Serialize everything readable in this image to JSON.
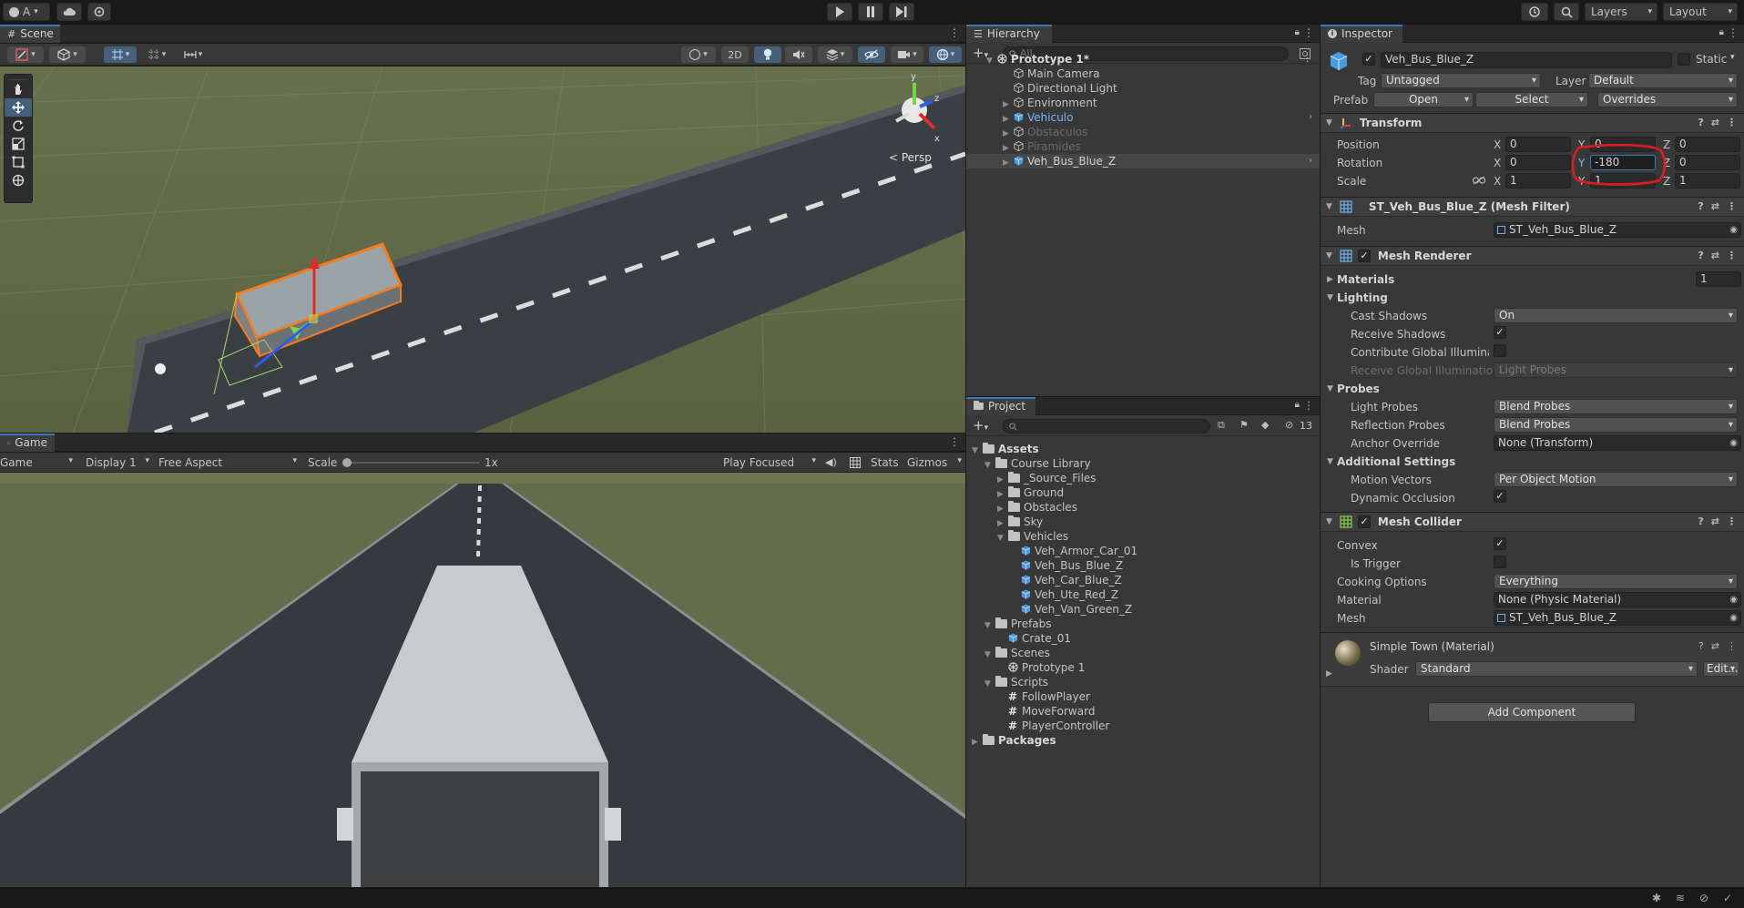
{
  "topbar": {
    "account_label": "A",
    "layers_label": "Layers",
    "layout_label": "Layout"
  },
  "scene": {
    "tab_label": "Scene",
    "mode_2d_label": "2D",
    "persp_label": "< Persp",
    "gizmo_axes": {
      "x": "x",
      "y": "y",
      "z": "z"
    }
  },
  "game": {
    "tab_label": "Game",
    "view_select": "Game",
    "display_select": "Display 1",
    "aspect_select": "Free Aspect",
    "scale_label": "Scale",
    "scale_value": "1x",
    "play_focused": "Play Focused",
    "stats_label": "Stats",
    "gizmos_label": "Gizmos"
  },
  "hierarchy": {
    "tab_label": "Hierarchy",
    "search_placeholder": "All",
    "scene_name": "Prototype 1*",
    "items": [
      {
        "label": "Main Camera",
        "type": "gameobject",
        "expandable": false,
        "color": "#c4c4c4"
      },
      {
        "label": "Directional Light",
        "type": "gameobject",
        "expandable": false,
        "color": "#c4c4c4"
      },
      {
        "label": "Environment",
        "type": "gameobject",
        "expandable": true,
        "color": "#c4c4c4"
      },
      {
        "label": "Vehiculo",
        "type": "prefab",
        "expandable": true,
        "color": "#7ab4f0"
      },
      {
        "label": "Obstaculos",
        "type": "gameobject",
        "expandable": true,
        "color": "#6b6b6b"
      },
      {
        "label": "Piramides",
        "type": "gameobject",
        "expandable": true,
        "color": "#6b6b6b"
      },
      {
        "label": "Veh_Bus_Blue_Z",
        "type": "prefab",
        "expandable": true,
        "color": "#d2d2d2",
        "selected": true
      }
    ]
  },
  "project": {
    "tab_label": "Project",
    "hidden_count": "13",
    "tree": [
      {
        "label": "Assets",
        "kind": "folder",
        "depth": 0,
        "open": true,
        "bold": true
      },
      {
        "label": "Course Library",
        "kind": "folder",
        "depth": 1,
        "open": true
      },
      {
        "label": "_Source_Files",
        "kind": "folder",
        "depth": 2,
        "open": false
      },
      {
        "label": "Ground",
        "kind": "folder",
        "depth": 2,
        "open": false
      },
      {
        "label": "Obstacles",
        "kind": "folder",
        "depth": 2,
        "open": false
      },
      {
        "label": "Sky",
        "kind": "folder",
        "depth": 2,
        "open": false
      },
      {
        "label": "Vehicles",
        "kind": "folder",
        "depth": 2,
        "open": true
      },
      {
        "label": "Veh_Armor_Car_01",
        "kind": "prefab",
        "depth": 3
      },
      {
        "label": "Veh_Bus_Blue_Z",
        "kind": "prefab",
        "depth": 3
      },
      {
        "label": "Veh_Car_Blue_Z",
        "kind": "prefab",
        "depth": 3
      },
      {
        "label": "Veh_Ute_Red_Z",
        "kind": "prefab",
        "depth": 3
      },
      {
        "label": "Veh_Van_Green_Z",
        "kind": "prefab",
        "depth": 3
      },
      {
        "label": "Prefabs",
        "kind": "folder",
        "depth": 1,
        "open": true
      },
      {
        "label": "Crate_01",
        "kind": "prefab",
        "depth": 2
      },
      {
        "label": "Scenes",
        "kind": "folder",
        "depth": 1,
        "open": true
      },
      {
        "label": "Prototype 1",
        "kind": "scene",
        "depth": 2
      },
      {
        "label": "Scripts",
        "kind": "folder",
        "depth": 1,
        "open": true
      },
      {
        "label": "FollowPlayer",
        "kind": "script",
        "depth": 2
      },
      {
        "label": "MoveForward",
        "kind": "script",
        "depth": 2
      },
      {
        "label": "PlayerController",
        "kind": "script",
        "depth": 2
      },
      {
        "label": "Packages",
        "kind": "folder",
        "depth": 0,
        "open": false,
        "bold": true
      }
    ]
  },
  "inspector": {
    "tab_label": "Inspector",
    "object_name": "Veh_Bus_Blue_Z",
    "static_label": "Static",
    "tag_label": "Tag",
    "tag_value": "Untagged",
    "layer_label": "Layer",
    "layer_value": "Default",
    "prefab_label": "Prefab",
    "prefab_open": "Open",
    "prefab_select": "Select",
    "prefab_overrides": "Overrides",
    "transform": {
      "title": "Transform",
      "position_label": "Position",
      "rotation_label": "Rotation",
      "scale_label": "Scale",
      "axis_x": "X",
      "axis_y": "Y",
      "axis_z": "Z",
      "position": {
        "x": "0",
        "y": "0",
        "z": "0"
      },
      "rotation": {
        "x": "0",
        "y": "-180",
        "z": "0"
      },
      "scale": {
        "x": "1",
        "y": "1",
        "z": "1"
      }
    },
    "mesh_filter": {
      "title": "ST_Veh_Bus_Blue_Z (Mesh Filter)",
      "mesh_label": "Mesh",
      "mesh_value": "ST_Veh_Bus_Blue_Z"
    },
    "mesh_renderer": {
      "title": "Mesh Renderer",
      "materials_label": "Materials",
      "materials_count": "1",
      "lighting_label": "Lighting",
      "cast_shadows_label": "Cast Shadows",
      "cast_shadows_value": "On",
      "receive_shadows_label": "Receive Shadows",
      "contribute_gi_label": "Contribute Global Illuminatic",
      "receive_gi_label": "Receive Global Illumination",
      "receive_gi_value": "Light Probes",
      "probes_label": "Probes",
      "light_probes_label": "Light Probes",
      "light_probes_value": "Blend Probes",
      "reflection_probes_label": "Reflection Probes",
      "reflection_probes_value": "Blend Probes",
      "anchor_override_label": "Anchor Override",
      "anchor_override_value": "None (Transform)",
      "additional_label": "Additional Settings",
      "motion_vectors_label": "Motion Vectors",
      "motion_vectors_value": "Per Object Motion",
      "dynamic_occlusion_label": "Dynamic Occlusion"
    },
    "mesh_collider": {
      "title": "Mesh Collider",
      "convex_label": "Convex",
      "is_trigger_label": "Is Trigger",
      "cooking_label": "Cooking Options",
      "cooking_value": "Everything",
      "material_label": "Material",
      "material_value": "None (Physic Material)",
      "mesh_label": "Mesh",
      "mesh_value": "ST_Veh_Bus_Blue_Z"
    },
    "material": {
      "title": "Simple Town (Material)",
      "shader_label": "Shader",
      "shader_value": "Standard",
      "edit_label": "Edit..."
    },
    "add_component_label": "Add Component"
  },
  "colors": {
    "accent_blue": "#3a79bb",
    "selection": "#2c5d87",
    "highlight_red": "#e01b24",
    "prefab_blue": "#7ab4f0"
  }
}
